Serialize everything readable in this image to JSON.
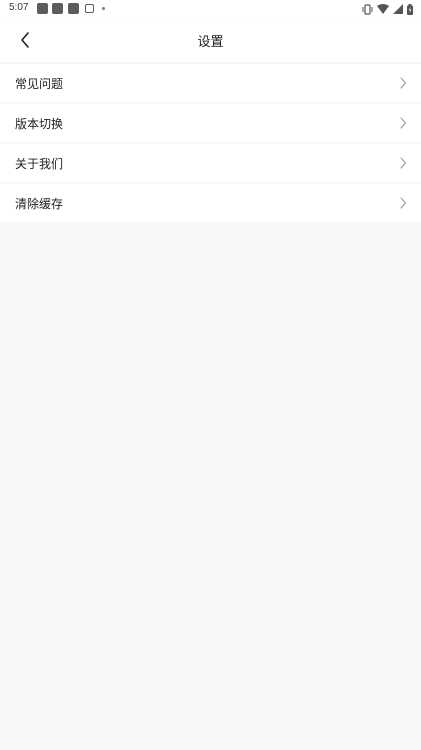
{
  "status_bar": {
    "time": "5:07",
    "icons": [
      "app-icon",
      "app-icon",
      "app-icon",
      "notification-icon",
      "dot-icon",
      "vibrate-icon",
      "wifi-icon",
      "signal-icon",
      "battery-icon"
    ]
  },
  "header": {
    "title": "设置",
    "back_icon": "chevron-left-icon"
  },
  "settings": {
    "items": [
      {
        "label": "常见问题"
      },
      {
        "label": "版本切换"
      },
      {
        "label": "关于我们"
      },
      {
        "label": "清除缓存"
      }
    ]
  }
}
